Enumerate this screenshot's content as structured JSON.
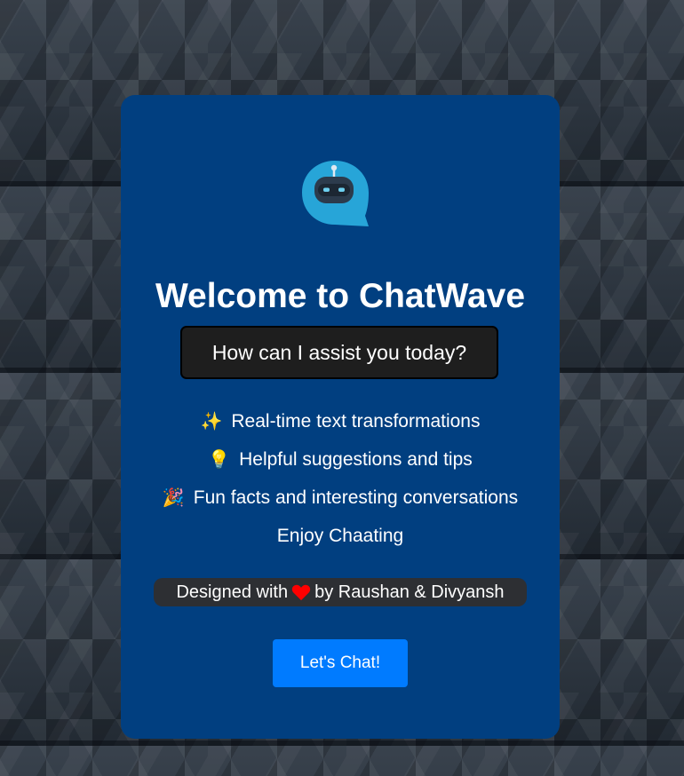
{
  "card": {
    "title": "Welcome to ChatWave",
    "prompt": "How can I assist you today?",
    "features": [
      {
        "icon": "sparkles-icon",
        "emoji": "✨",
        "text": "Real-time text transformations"
      },
      {
        "icon": "lightbulb-icon",
        "emoji": "💡",
        "text": "Helpful suggestions and tips"
      },
      {
        "icon": "party-popper-icon",
        "emoji": "🎉",
        "text": "Fun facts and interesting conversations"
      }
    ],
    "enjoy": "Enjoy Chaating",
    "credit": {
      "prefix": "Designed with",
      "icon": "heart-icon",
      "suffix": "by Raushan & Divyansh"
    },
    "button_label": "Let's Chat!"
  },
  "colors": {
    "card_background": "#013f80",
    "prompt_background": "#1e1e1e",
    "credit_background": "#2d2f33",
    "button": "#007bff",
    "heart": "#ff0000",
    "logo_bubble": "#27a5d8"
  }
}
